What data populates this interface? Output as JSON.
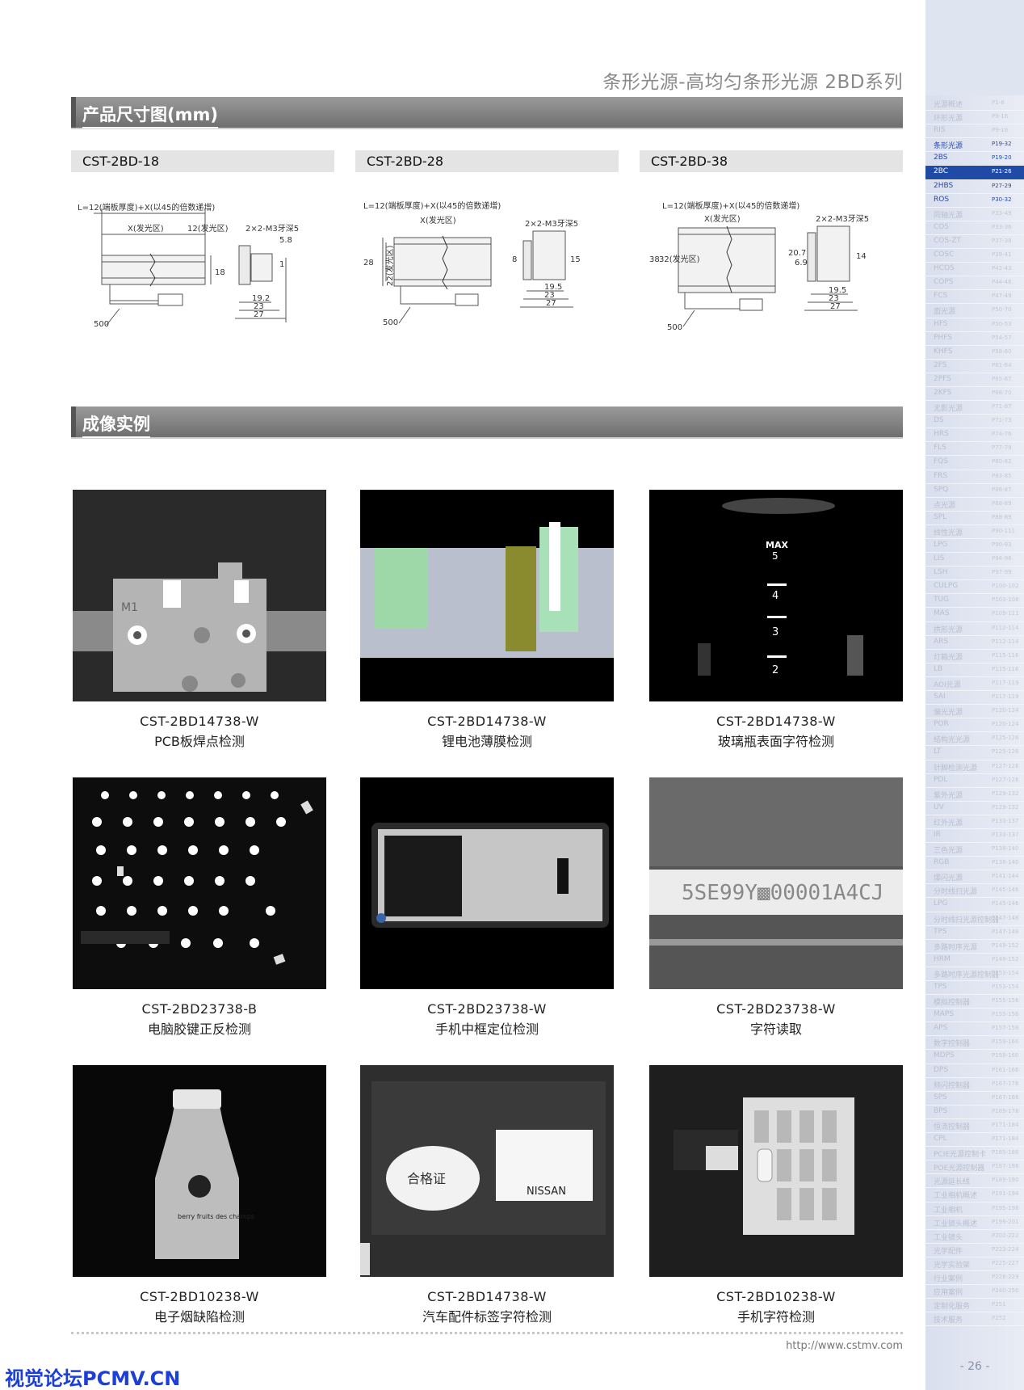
{
  "header": {
    "title": "条形光源-高均匀条形光源 2BD系列"
  },
  "sections": {
    "dimensions": "产品尺寸图(mm)",
    "examples": "成像实例"
  },
  "models": [
    {
      "name": "CST-2BD-18",
      "length_formula": "L=12(端板厚度)+X(以45的倍数递增)",
      "lit_zone": "X(发光区)",
      "end_plate": "12(发光区)",
      "screw": "2×2-M3牙深5",
      "dim_a": "5.8",
      "dim_h": "18",
      "dim_1": "19.2",
      "dim_2": "23",
      "dim_3": "27",
      "cable": "500",
      "side_small": "1"
    },
    {
      "name": "CST-2BD-28",
      "length_formula": "L=12(端板厚度)+X(以45的倍数递增)",
      "lit_zone": "X(发光区)",
      "screw": "2×2-M3牙深5",
      "dim_h": "28",
      "dim_h2": "22(发光区)",
      "dim_8": "8",
      "dim_15": "15",
      "dim_1": "19.5",
      "dim_2": "23",
      "dim_3": "27",
      "cable": "500"
    },
    {
      "name": "CST-2BD-38",
      "length_formula": "L=12(端板厚度)+X(以45的倍数递增)",
      "lit_zone": "X(发光区)",
      "screw": "2×2-M3牙深5",
      "dim_h": "38",
      "dim_h2": "32(发光区)",
      "dim_a": "20.7",
      "dim_b": "6.9",
      "dim_14": "14",
      "dim_1": "19.5",
      "dim_2": "23",
      "dim_3": "27",
      "cable": "500"
    }
  ],
  "examples": [
    {
      "model": "CST-2BD14738-W",
      "desc": "PCB板焊点检测",
      "img_text": "M1"
    },
    {
      "model": "CST-2BD14738-W",
      "desc": "锂电池薄膜检测"
    },
    {
      "model": "CST-2BD14738-W",
      "desc": "玻璃瓶表面字符检测",
      "img_marks": [
        "MAX",
        "5",
        "4",
        "3",
        "2"
      ]
    },
    {
      "model": "CST-2BD23738-B",
      "desc": "电脑胶键正反检测"
    },
    {
      "model": "CST-2BD23738-W",
      "desc": "手机中框定位检测"
    },
    {
      "model": "CST-2BD23738-W",
      "desc": "字符读取",
      "img_text": "5SE99Y▩00001A4CJ"
    },
    {
      "model": "CST-2BD10238-W",
      "desc": "电子烟缺陷检测",
      "img_text": "berry fruits des champs"
    },
    {
      "model": "CST-2BD14738-W",
      "desc": "汽车配件标签字符检测",
      "img_stamp": "合格证",
      "img_label": "NISSAN"
    },
    {
      "model": "CST-2BD10238-W",
      "desc": "手机字符检测"
    }
  ],
  "footer": {
    "url": "http://www.cstmv.com",
    "watermark": "视觉论坛PCMV.CN",
    "page": "- 26 -"
  },
  "sidebar": {
    "items": [
      {
        "name": "光源概述",
        "pages": "P1-8"
      },
      {
        "name": "环形光源",
        "pages": "P9-18"
      },
      {
        "name": "RIS",
        "pages": "P9-18"
      },
      {
        "name": "条形光源",
        "pages": "P19-32",
        "hl": true
      },
      {
        "name": "2BS",
        "pages": "P19-20",
        "hl": true
      },
      {
        "name": "2BC",
        "pages": "P21-26",
        "active": true
      },
      {
        "name": "2HBS",
        "pages": "P27-29",
        "hl": true
      },
      {
        "name": "ROS",
        "pages": "P30-32",
        "hl": true
      },
      {
        "name": "同轴光源",
        "pages": "P33-49"
      },
      {
        "name": "COS",
        "pages": "P33-36"
      },
      {
        "name": "COS-ZT",
        "pages": "P37-38"
      },
      {
        "name": "COSC",
        "pages": "P39-41"
      },
      {
        "name": "HCOS",
        "pages": "P42-43"
      },
      {
        "name": "COPS",
        "pages": "P44-46"
      },
      {
        "name": "FCS",
        "pages": "P47-49"
      },
      {
        "name": "面光源",
        "pages": "P50-70"
      },
      {
        "name": "HFS",
        "pages": "P50-53"
      },
      {
        "name": "PHFS",
        "pages": "P54-57"
      },
      {
        "name": "KHFS",
        "pages": "P58-60"
      },
      {
        "name": "2FS",
        "pages": "P61-64"
      },
      {
        "name": "2PFS",
        "pages": "P65-67"
      },
      {
        "name": "2KFS",
        "pages": "P68-70"
      },
      {
        "name": "无影光源",
        "pages": "P71-87"
      },
      {
        "name": "DS",
        "pages": "P71-73"
      },
      {
        "name": "HRS",
        "pages": "P74-76"
      },
      {
        "name": "FLS",
        "pages": "P77-79"
      },
      {
        "name": "FQS",
        "pages": "P80-82"
      },
      {
        "name": "FRS",
        "pages": "P83-85"
      },
      {
        "name": "SPQ",
        "pages": "P86-87"
      },
      {
        "name": "点光源",
        "pages": "P88-89"
      },
      {
        "name": "SPL",
        "pages": "P88-89"
      },
      {
        "name": "线性光源",
        "pages": "P90-111"
      },
      {
        "name": "LPG",
        "pages": "P90-93"
      },
      {
        "name": "LIS",
        "pages": "P94-96"
      },
      {
        "name": "LSH",
        "pages": "P97-99"
      },
      {
        "name": "CULPG",
        "pages": "P100-102"
      },
      {
        "name": "TUG",
        "pages": "P103-108"
      },
      {
        "name": "MAS",
        "pages": "P109-111"
      },
      {
        "name": "拱形光源",
        "pages": "P112-114"
      },
      {
        "name": "ARS",
        "pages": "P112-114"
      },
      {
        "name": "灯箱光源",
        "pages": "P115-116"
      },
      {
        "name": "LB",
        "pages": "P115-116"
      },
      {
        "name": "AOI光源",
        "pages": "P117-119"
      },
      {
        "name": "SAI",
        "pages": "P117-119"
      },
      {
        "name": "偏光光源",
        "pages": "P120-124"
      },
      {
        "name": "POR",
        "pages": "P120-124"
      },
      {
        "name": "结构光光源",
        "pages": "P125-126"
      },
      {
        "name": "LT",
        "pages": "P125-126"
      },
      {
        "name": "针脚检测光源",
        "pages": "P127-128"
      },
      {
        "name": "PDL",
        "pages": "P127-128"
      },
      {
        "name": "紫外光源",
        "pages": "P129-132"
      },
      {
        "name": "UV",
        "pages": "P129-132"
      },
      {
        "name": "红外光源",
        "pages": "P133-137"
      },
      {
        "name": "IR",
        "pages": "P133-137"
      },
      {
        "name": "三色光源",
        "pages": "P138-140"
      },
      {
        "name": "RGB",
        "pages": "P138-140"
      },
      {
        "name": "爆闪光源",
        "pages": "P141-144"
      },
      {
        "name": "分时线扫光源",
        "pages": "P145-146"
      },
      {
        "name": "LPG",
        "pages": "P145-146"
      },
      {
        "name": "分时线扫光源控制器",
        "pages": "P147-148"
      },
      {
        "name": "TPS",
        "pages": "P147-148"
      },
      {
        "name": "多路时序光源",
        "pages": "P149-152"
      },
      {
        "name": "HRM",
        "pages": "P149-152"
      },
      {
        "name": "多路时序光源控制器",
        "pages": "P153-154"
      },
      {
        "name": "TPS",
        "pages": "P153-154"
      },
      {
        "name": "模拟控制器",
        "pages": "P155-158"
      },
      {
        "name": "MAPS",
        "pages": "P155-156"
      },
      {
        "name": "APS",
        "pages": "P157-158"
      },
      {
        "name": "数字控制器",
        "pages": "P159-166"
      },
      {
        "name": "MDPS",
        "pages": "P159-160"
      },
      {
        "name": "DPS",
        "pages": "P161-166"
      },
      {
        "name": "频闪控制器",
        "pages": "P167-178"
      },
      {
        "name": "SPS",
        "pages": "P167-168"
      },
      {
        "name": "BPS",
        "pages": "P169-178"
      },
      {
        "name": "恒流控制器",
        "pages": "P171-184"
      },
      {
        "name": "CPL",
        "pages": "P171-184"
      },
      {
        "name": "PCIE光源控制卡",
        "pages": "P185-186"
      },
      {
        "name": "POE光源控制器",
        "pages": "P187-188"
      },
      {
        "name": "光源延长线",
        "pages": "P189-190"
      },
      {
        "name": "工业相机概述",
        "pages": "P191-194"
      },
      {
        "name": "工业相机",
        "pages": "P195-198"
      },
      {
        "name": "工业镜头概述",
        "pages": "P199-201"
      },
      {
        "name": "工业镜头",
        "pages": "P202-222"
      },
      {
        "name": "光学配件",
        "pages": "P223-224"
      },
      {
        "name": "光学实验架",
        "pages": "P225-227"
      },
      {
        "name": "行业案例",
        "pages": "P228-229"
      },
      {
        "name": "应用案例",
        "pages": "P240-250"
      },
      {
        "name": "定制化服务",
        "pages": "P251"
      },
      {
        "name": "技术服务",
        "pages": "P252"
      }
    ]
  }
}
